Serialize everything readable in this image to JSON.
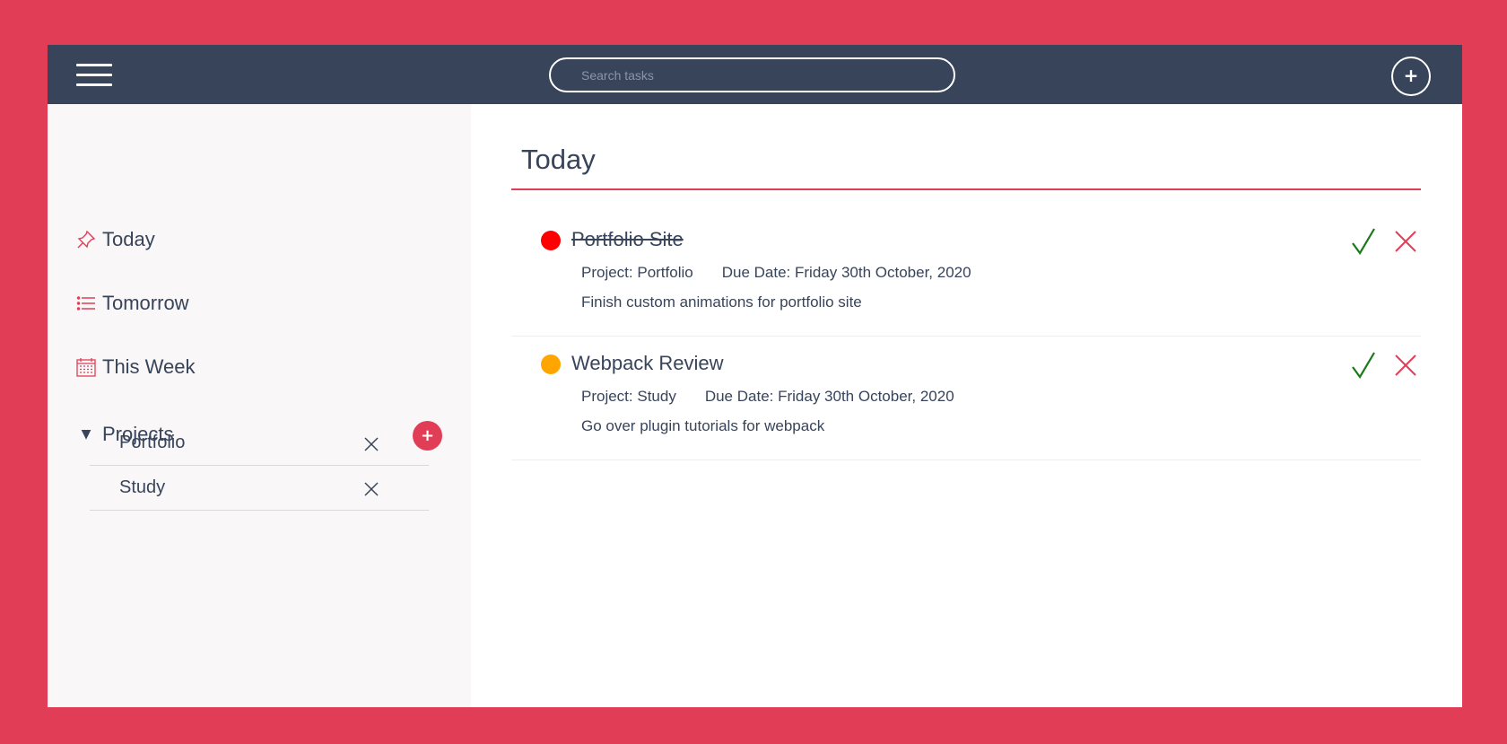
{
  "header": {
    "search_placeholder": "Search tasks",
    "add_label": "+"
  },
  "sidebar": {
    "items": [
      {
        "label": "Today",
        "icon": "pushpin-icon"
      },
      {
        "label": "Tomorrow",
        "icon": "list-icon"
      },
      {
        "label": "This Week",
        "icon": "calendar-icon"
      }
    ],
    "projects_label": "Projects",
    "projects_toggle": "▼",
    "add_project_label": "+",
    "projects": [
      {
        "name": "Portfolio"
      },
      {
        "name": "Study"
      }
    ]
  },
  "main": {
    "title": "Today",
    "tasks": [
      {
        "title": "Portfolio Site",
        "completed": true,
        "priority_color": "#ff0000",
        "project": "Project: Portfolio",
        "due": "Due Date: Friday 30th October, 2020",
        "description": "Finish custom animations for portfolio site"
      },
      {
        "title": "Webpack Review",
        "completed": false,
        "priority_color": "#ffa500",
        "project": "Project: Study",
        "due": "Due Date: Friday 30th October, 2020",
        "description": "Go over plugin tutorials for webpack"
      }
    ]
  },
  "colors": {
    "accent": "#e23d57",
    "header_bg": "#38445a",
    "sidebar_bg": "#f9f7f7",
    "check": "#1a7a1a"
  }
}
